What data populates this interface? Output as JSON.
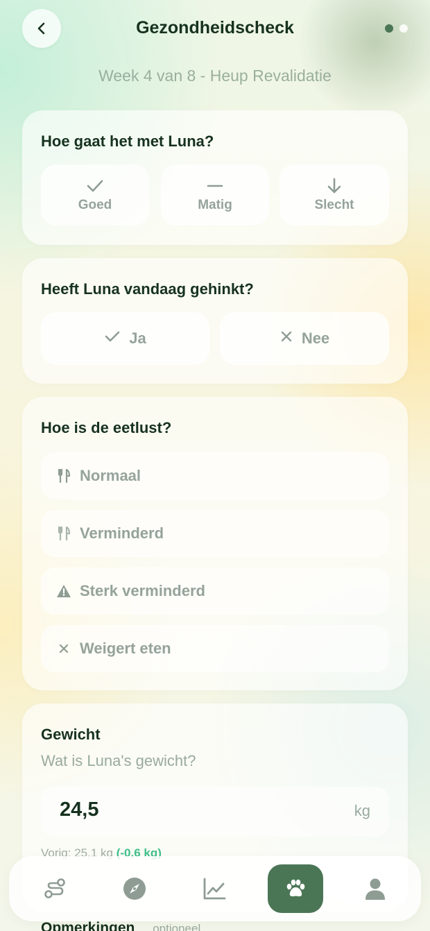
{
  "header": {
    "title": "Gezondheidscheck",
    "subtitle": "Week 4 van 8 - Heup Revalidatie",
    "back_icon": "chevron-left-icon",
    "progress_dots": {
      "total": 2,
      "active": 1
    }
  },
  "mood": {
    "question": "Hoe gaat het met Luna?",
    "options": [
      {
        "label": "Goed",
        "icon": "check-icon"
      },
      {
        "label": "Matig",
        "icon": "minus-icon"
      },
      {
        "label": "Slecht",
        "icon": "arrow-down-icon"
      }
    ]
  },
  "limp": {
    "question": "Heeft Luna vandaag gehinkt?",
    "options": [
      {
        "label": "Ja",
        "icon": "check-icon"
      },
      {
        "label": "Nee",
        "icon": "close-icon"
      }
    ]
  },
  "appetite": {
    "question": "Hoe is de eetlust?",
    "options": [
      {
        "label": "Normaal",
        "icon": "utensils-icon"
      },
      {
        "label": "Verminderd",
        "icon": "utensils-icon"
      },
      {
        "label": "Sterk verminderd",
        "icon": "warning-icon"
      },
      {
        "label": "Weigert eten",
        "icon": "close-icon"
      }
    ]
  },
  "weight": {
    "title": "Gewicht",
    "question": "Wat is Luna's gewicht?",
    "value": "24,5",
    "unit": "kg",
    "previous_label": "Vorig: 25,1 kg",
    "previous_diff": "(-0,6 kg)"
  },
  "remarks": {
    "title": "Opmerkingen",
    "optional_label": "optioneel"
  },
  "bottom_nav": {
    "items": [
      {
        "name": "route",
        "icon": "route-icon"
      },
      {
        "name": "explore",
        "icon": "compass-icon"
      },
      {
        "name": "stats",
        "icon": "chart-icon"
      },
      {
        "name": "pet",
        "icon": "paw-icon",
        "active": true
      },
      {
        "name": "profile",
        "icon": "user-icon"
      }
    ]
  },
  "colors": {
    "accent": "#4b7656",
    "title_text": "#17321f",
    "muted_text": "#95a39a",
    "positive": "#3fbf8a"
  }
}
